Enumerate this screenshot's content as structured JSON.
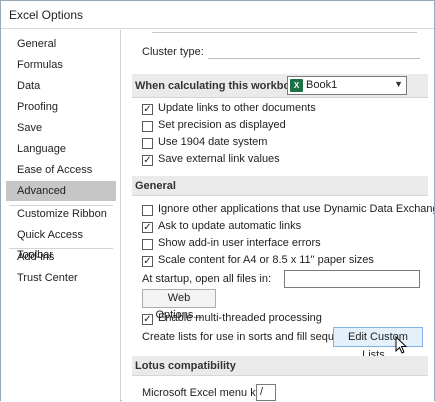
{
  "window": {
    "title": "Excel Options"
  },
  "nav": {
    "items": [
      {
        "label": "General"
      },
      {
        "label": "Formulas"
      },
      {
        "label": "Data"
      },
      {
        "label": "Proofing"
      },
      {
        "label": "Save"
      },
      {
        "label": "Language"
      },
      {
        "label": "Ease of Access"
      },
      {
        "label": "Advanced",
        "selected": true
      },
      {
        "label": "Customize Ribbon"
      },
      {
        "label": "Quick Access Toolbar"
      },
      {
        "label": "Add-ins"
      },
      {
        "label": "Trust Center"
      }
    ]
  },
  "content": {
    "cluster_type": {
      "label": "Cluster type:"
    },
    "calc_section": {
      "title": "When calculating this workbook:",
      "workbook": "Book1",
      "workbook_icon": "excel-workbook-icon",
      "options": [
        {
          "label": "Update links to other documents",
          "checked": true
        },
        {
          "label": "Set precision as displayed",
          "checked": false
        },
        {
          "label": "Use 1904 date system",
          "checked": false
        },
        {
          "label": "Save external link values",
          "checked": true
        }
      ]
    },
    "general_section": {
      "title": "General",
      "options": [
        {
          "label": "Ignore other applications that use Dynamic Data Exchange (DDE)",
          "checked": false
        },
        {
          "label": "Ask to update automatic links",
          "checked": true
        },
        {
          "label": "Show add-in user interface errors",
          "checked": false
        },
        {
          "label": "Scale content for A4 or 8.5 x 11\" paper sizes",
          "checked": true
        }
      ],
      "startup_label": "At startup, open all files in:",
      "startup_value": "",
      "web_options_label": "Web Options...",
      "multithread_label": "Enable multi-threaded processing",
      "multithread_checked": true,
      "custom_lists_text": "Create lists for use in sorts and fill sequences:",
      "edit_custom_lists_label": "Edit Custom Lists..."
    },
    "lotus_section": {
      "title": "Lotus compatibility",
      "menu_key_label": "Microsoft Excel menu key:",
      "menu_key_value": "/"
    }
  },
  "colors": {
    "nav_selected": "#c6c6c6",
    "section_header": "#eaeaea",
    "excel_green": "#1e7145",
    "button_hover": "#e4f1fb"
  }
}
